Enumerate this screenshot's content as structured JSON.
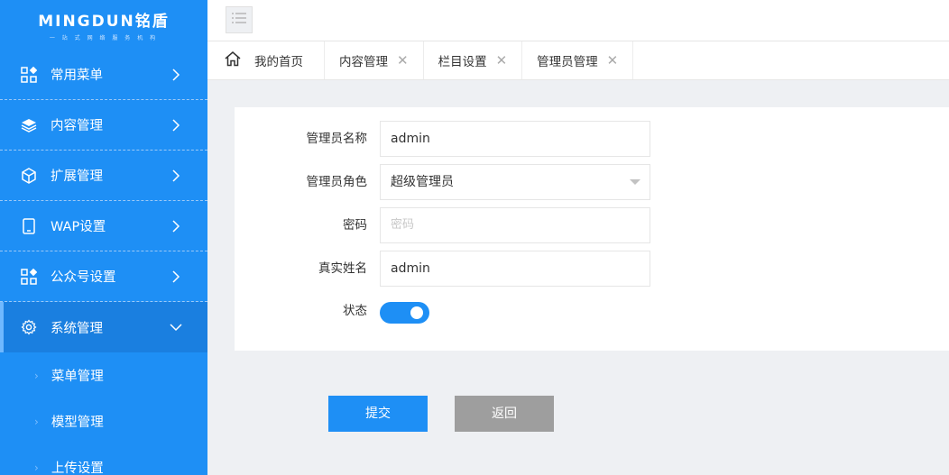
{
  "logo": {
    "main": "MINGDUN铭盾",
    "sub": "一 站 式 网 络 服 务 机 构"
  },
  "sidebar": {
    "items": [
      {
        "label": "常用菜单",
        "icon": "apps-icon"
      },
      {
        "label": "内容管理",
        "icon": "layers-icon"
      },
      {
        "label": "扩展管理",
        "icon": "cube-icon"
      },
      {
        "label": "WAP设置",
        "icon": "mobile-icon"
      },
      {
        "label": "公众号设置",
        "icon": "apps-icon"
      },
      {
        "label": "系统管理",
        "icon": "gear-icon",
        "expanded": true
      }
    ],
    "sub_items": [
      {
        "label": "菜单管理"
      },
      {
        "label": "模型管理"
      },
      {
        "label": "上传设置"
      }
    ]
  },
  "tabs": {
    "home": "我的首页",
    "items": [
      {
        "label": "内容管理"
      },
      {
        "label": "栏目设置"
      },
      {
        "label": "管理员管理"
      }
    ]
  },
  "form": {
    "name_label": "管理员名称",
    "name_value": "admin",
    "role_label": "管理员角色",
    "role_value": "超级管理员",
    "password_label": "密码",
    "password_placeholder": "密码",
    "realname_label": "真实姓名",
    "realname_value": "admin",
    "status_label": "状态",
    "status_on": true
  },
  "buttons": {
    "submit": "提交",
    "back": "返回"
  },
  "colors": {
    "primary": "#1e8ff5",
    "sidebar_active": "#1a7fe0",
    "back_button": "#9e9e9e"
  }
}
